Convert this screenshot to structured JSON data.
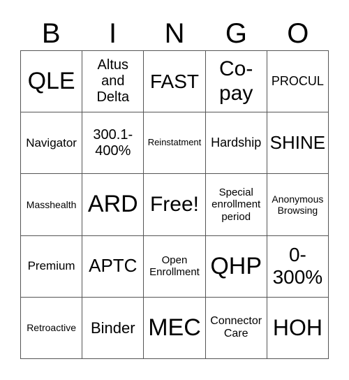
{
  "header": [
    "B",
    "I",
    "N",
    "G",
    "O"
  ],
  "cells": [
    [
      "QLE",
      "Altus and Delta",
      "FAST",
      "Co-pay",
      "PROCUL"
    ],
    [
      "Navigator",
      "300.1-400%",
      "Reinstatment",
      "Hardship",
      "SHINE"
    ],
    [
      "Masshealth",
      "ARD",
      "Free!",
      "Special enrollment period",
      "Anonymous Browsing"
    ],
    [
      "Premium",
      "APTC",
      "Open Enrollment",
      "QHP",
      "0-300%"
    ],
    [
      "Retroactive",
      "Binder",
      "MEC",
      "Connector Care",
      "HOH"
    ]
  ]
}
